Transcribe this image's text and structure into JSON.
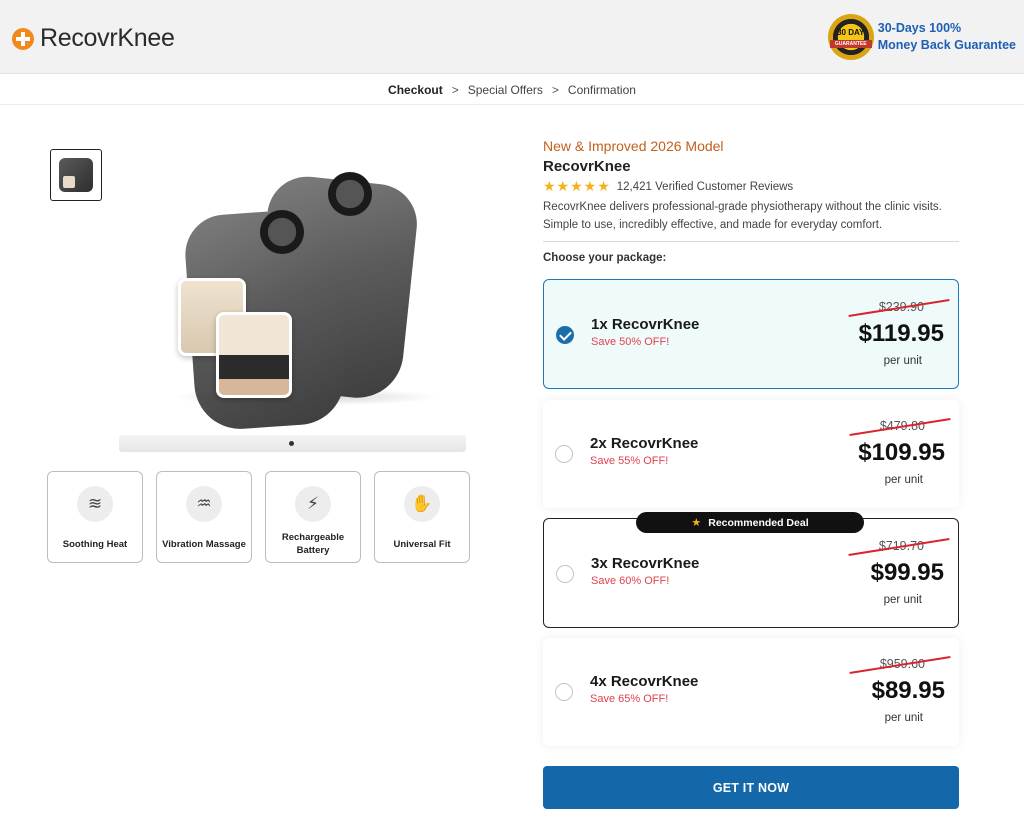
{
  "brand": {
    "name": "RecovrKnee",
    "logo_icon": "plus-cross-icon"
  },
  "guarantee": {
    "seal_top": "30 DAY",
    "seal_ribbon": "GUARANTEE",
    "line1": "30-Days 100%",
    "line2": "Money Back Guarantee"
  },
  "breadcrumb": {
    "items": [
      "Checkout",
      "Special Offers",
      "Confirmation"
    ],
    "separator": ">"
  },
  "features": [
    {
      "label": "Soothing Heat",
      "icon": "heat-waves-icon",
      "glyph": "≋"
    },
    {
      "label": "Vibration Massage",
      "icon": "vibration-icon",
      "glyph": "♒"
    },
    {
      "label": "Rechargeable Battery",
      "icon": "battery-icon",
      "glyph": "⚡"
    },
    {
      "label": "Universal Fit",
      "icon": "knee-fit-icon",
      "glyph": "✋"
    }
  ],
  "product": {
    "model": "New & Improved 2026 Model",
    "name": "RecovrKnee",
    "stars": "★★★★★",
    "rating": 4.5,
    "reviews": "12,421 Verified Customer Reviews",
    "description": "RecovrKnee delivers professional-grade physiotherapy without the clinic visits. Simple to use, incredibly effective, and made for everyday comfort.",
    "choose_label": "Choose your package:"
  },
  "packages": [
    {
      "title": "1x RecovrKnee",
      "save": "Save 50% OFF!",
      "old_price": "$239.90",
      "price": "$119.95",
      "unit": "per unit",
      "selected": true
    },
    {
      "title": "2x RecovrKnee",
      "save": "Save 55% OFF!",
      "old_price": "$479.80",
      "price": "$109.95",
      "unit": "per unit",
      "selected": false
    },
    {
      "title": "3x RecovrKnee",
      "save": "Save 60% OFF!",
      "old_price": "$719.70",
      "price": "$99.95",
      "unit": "per unit",
      "selected": false,
      "badge": "Recommended Deal"
    },
    {
      "title": "4x RecovrKnee",
      "save": "Save 65% OFF!",
      "old_price": "$959.60",
      "price": "$89.95",
      "unit": "per unit",
      "selected": false
    }
  ],
  "cta": {
    "label": "GET IT NOW"
  },
  "colors": {
    "accent": "#1467a8",
    "save_red": "#e2414f",
    "model_orange": "#c4601c",
    "star": "#f3b21b"
  }
}
